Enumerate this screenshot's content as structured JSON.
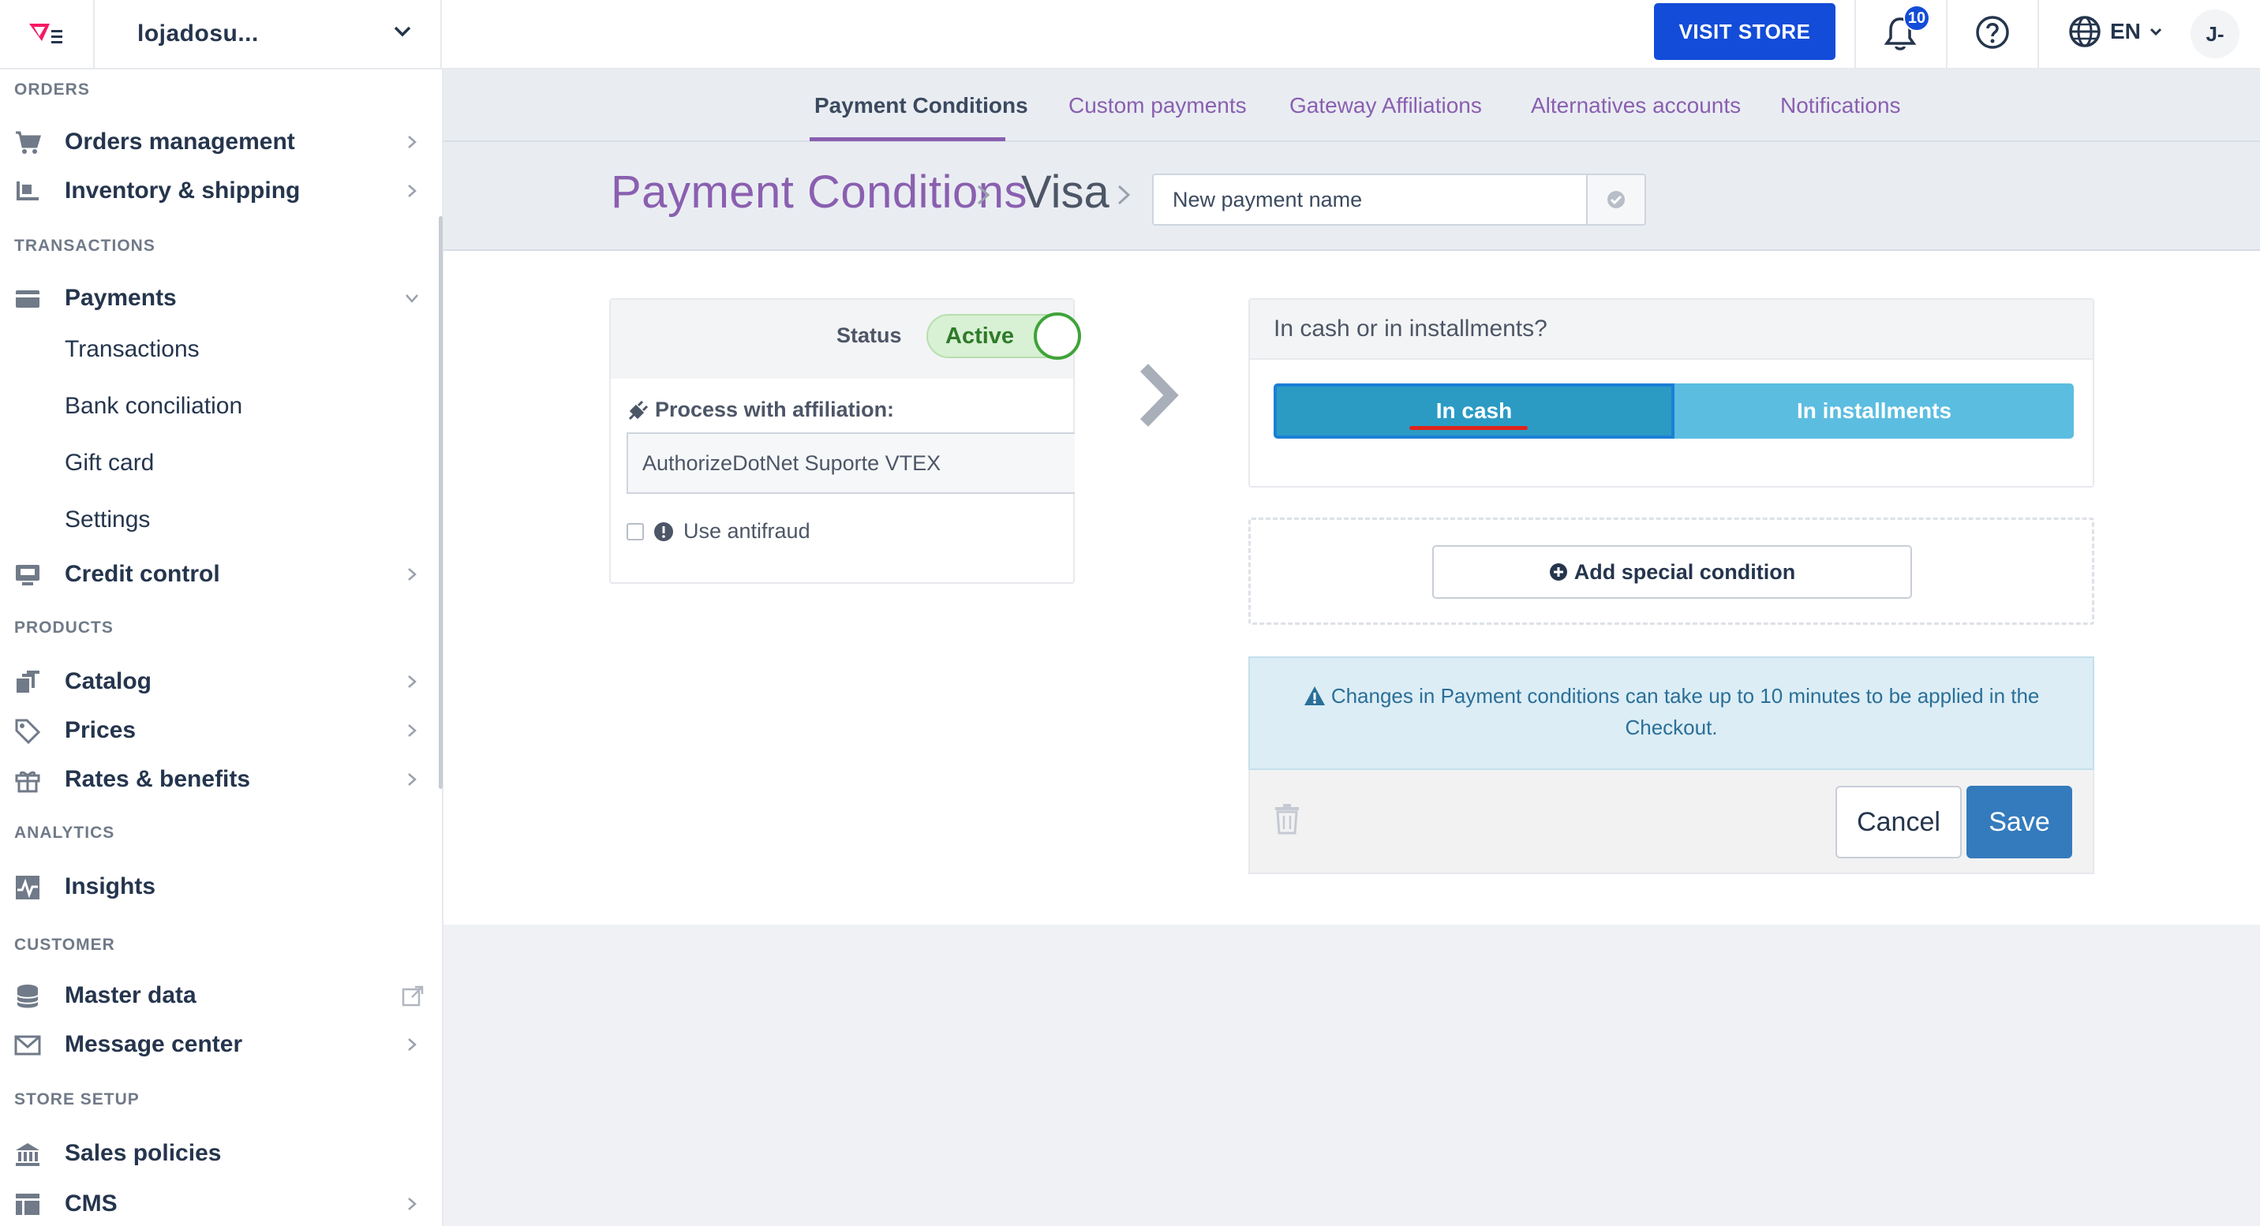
{
  "topbar": {
    "store_name": "lojadosu...",
    "visit_store": "VISIT STORE",
    "notifications_count": "10",
    "language": "EN",
    "avatar_initials": "J-"
  },
  "sidebar": {
    "sections": {
      "orders": "ORDERS",
      "transactions": "TRANSACTIONS",
      "products": "PRODUCTS",
      "analytics": "ANALYTICS",
      "customer": "CUSTOMER",
      "store_setup": "STORE SETUP"
    },
    "items": {
      "orders_management": "Orders management",
      "inventory_shipping": "Inventory & shipping",
      "payments": "Payments",
      "transactions": "Transactions",
      "bank_conciliation": "Bank conciliation",
      "gift_card": "Gift card",
      "settings": "Settings",
      "credit_control": "Credit control",
      "catalog": "Catalog",
      "prices": "Prices",
      "rates_benefits": "Rates & benefits",
      "insights": "Insights",
      "master_data": "Master data",
      "message_center": "Message center",
      "sales_policies": "Sales policies",
      "cms": "CMS"
    }
  },
  "tabs": [
    {
      "label": "Payment Conditions",
      "active": true
    },
    {
      "label": "Custom payments",
      "active": false
    },
    {
      "label": "Gateway Affiliations",
      "active": false
    },
    {
      "label": "Alternatives accounts",
      "active": false
    },
    {
      "label": "Notifications",
      "active": false
    }
  ],
  "breadcrumb": {
    "root": "Payment Conditions",
    "current": "Visa",
    "name_placeholder": "New payment name"
  },
  "condition": {
    "status_label": "Status",
    "status_value": "Active",
    "affiliation_label": "Process with affiliation:",
    "affiliation_value": "AuthorizeDotNet Suporte VTEX",
    "antifraud_label": "Use antifraud"
  },
  "installments": {
    "question": "In cash or in installments?",
    "cash_label": "In cash",
    "installments_label": "In installments",
    "selected": "In cash"
  },
  "special_condition_label": "Add special condition",
  "alert_text": "Changes in Payment conditions can take up to 10 minutes to be applied in the Checkout.",
  "actions": {
    "cancel": "Cancel",
    "save": "Save"
  },
  "colors": {
    "brand_blue": "#134cd8",
    "purple_accent": "#8a5fb0",
    "cash_selected": "#2b9bc4",
    "installments": "#5bbde0",
    "save": "#347bbd",
    "active_green": "#3fa339"
  }
}
